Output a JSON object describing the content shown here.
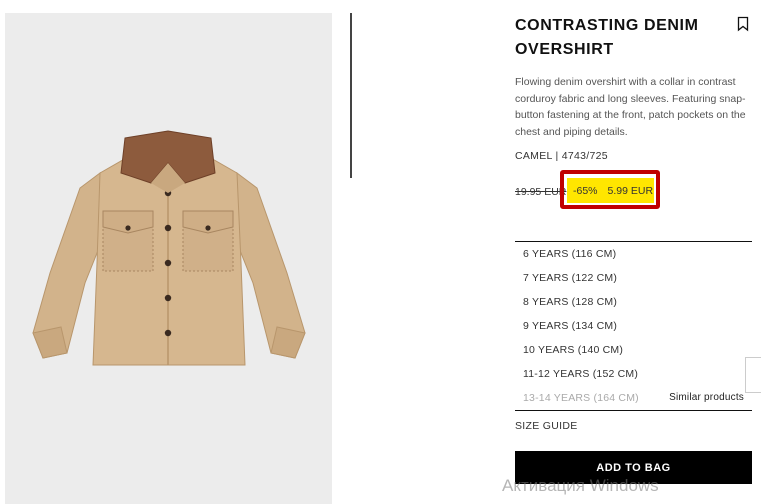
{
  "product": {
    "title_line1": "CONTRASTING DENIM",
    "title_line2": "OVERSHIRT",
    "description": "Flowing denim overshirt with a collar in contrast corduroy fabric and long sleeves. Featuring snap-button fastening at the front, patch pockets on the chest and piping details.",
    "color_ref": "CAMEL | 4743/725",
    "old_price": "19.95 EUR",
    "discount": "-65%",
    "price": "5.99 EUR"
  },
  "sizes": [
    {
      "label": "6 YEARS (116 CM)",
      "available": true
    },
    {
      "label": "7 YEARS (122 CM)",
      "available": true
    },
    {
      "label": "8 YEARS (128 CM)",
      "available": true
    },
    {
      "label": "9 YEARS (134 CM)",
      "available": true
    },
    {
      "label": "10 YEARS (140 CM)",
      "available": true
    },
    {
      "label": "11-12 YEARS (152 CM)",
      "available": true
    },
    {
      "label": "13-14 YEARS (164 CM)",
      "available": false
    }
  ],
  "similar_products_label": "Similar products",
  "size_guide_label": "SIZE GUIDE",
  "add_to_bag_label": "ADD TO BAG",
  "watermark_text": "Активация Windows",
  "colors": {
    "highlight": "#ffe600",
    "annotation_border": "#c00000",
    "button_bg": "#000000",
    "jacket": "#d4b48c",
    "collar": "#8b5a3c"
  }
}
